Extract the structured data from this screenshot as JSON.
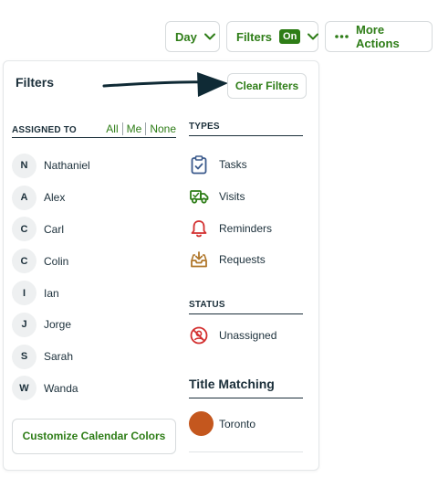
{
  "toolbar": {
    "day_label": "Day",
    "filters_label": "Filters",
    "filters_badge": "On",
    "more_label": "More Actions"
  },
  "panel": {
    "title": "Filters",
    "clear_label": "Clear Filters",
    "customize_label": "Customize Calendar Colors"
  },
  "assigned": {
    "heading": "ASSIGNED TO",
    "all": "All",
    "me": "Me",
    "none": "None",
    "people": [
      {
        "initial": "N",
        "name": "Nathaniel"
      },
      {
        "initial": "A",
        "name": "Alex"
      },
      {
        "initial": "C",
        "name": "Carl"
      },
      {
        "initial": "C",
        "name": "Colin"
      },
      {
        "initial": "I",
        "name": "Ian"
      },
      {
        "initial": "J",
        "name": "Jorge"
      },
      {
        "initial": "S",
        "name": "Sarah"
      },
      {
        "initial": "W",
        "name": "Wanda"
      }
    ]
  },
  "types": {
    "heading": "TYPES",
    "items": [
      {
        "label": "Tasks",
        "icon": "clipboard-check-icon"
      },
      {
        "label": "Visits",
        "icon": "truck-icon"
      },
      {
        "label": "Reminders",
        "icon": "bell-icon"
      },
      {
        "label": "Requests",
        "icon": "inbox-download-icon"
      }
    ]
  },
  "status": {
    "heading": "STATUS",
    "unassigned": "Unassigned"
  },
  "title_matching": {
    "heading": "Title Matching",
    "items": [
      {
        "label": "Toronto",
        "color": "#c4571e"
      }
    ]
  },
  "colors": {
    "accent": "#2e7d17",
    "text": "#1b2f3a",
    "reminder": "#d32f2f",
    "request": "#b0772b",
    "task": "#3b5a8c"
  }
}
